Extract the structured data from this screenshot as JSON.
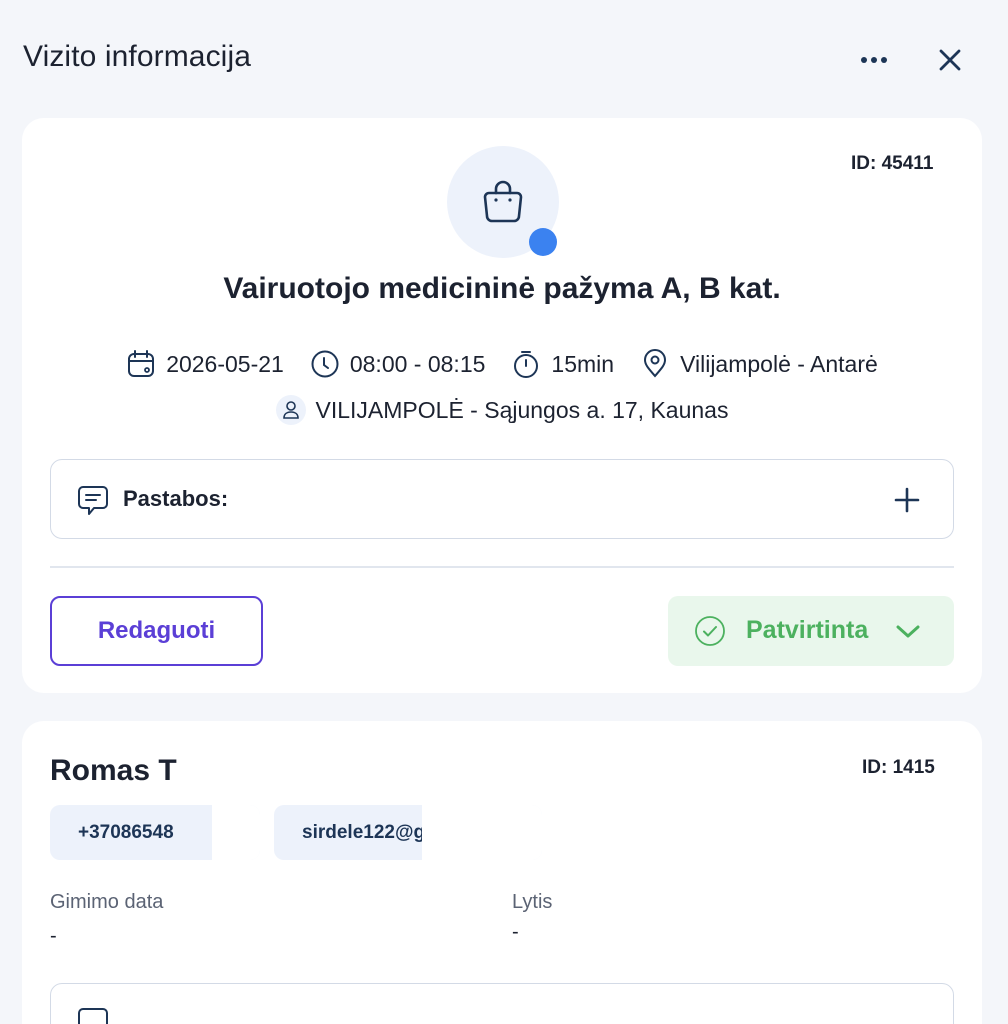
{
  "header": {
    "title": "Vizito informacija",
    "more_icon": "more-horizontal-icon",
    "close_icon": "close-icon"
  },
  "visit": {
    "id_label": "ID: 45411",
    "service_icon": "shopping-bag-icon",
    "status_dot_color": "#3b82f0",
    "title": "Vairuotojo medicininė pažyma A, B kat.",
    "date": "2026-05-21",
    "time": "08:00 - 08:15",
    "duration": "15min",
    "location": "Vilijampolė - Antarė",
    "specialist": "VILIJAMPOLĖ - Sąjungos a. 17, Kaunas",
    "notes_label": "Pastabos:",
    "edit_label": "Redaguoti",
    "status_label": "Patvirtinta",
    "status_color": "#4cb15f",
    "accent_color": "#5b3fd6"
  },
  "client": {
    "id_label": "ID: 1415",
    "name": "Romas T",
    "phone": "+37086548",
    "email": "sirdele122@g",
    "birth_date_label": "Gimimo data",
    "birth_date_value": "-",
    "gender_label": "Lytis",
    "gender_value": "-"
  }
}
